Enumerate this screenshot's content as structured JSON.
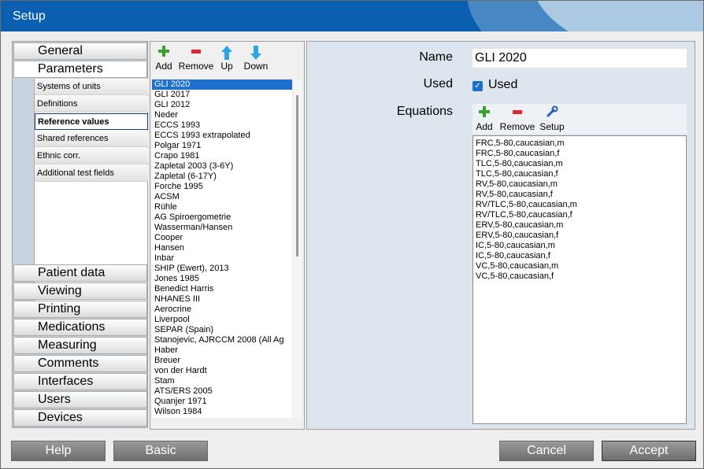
{
  "window": {
    "title": "Setup"
  },
  "nav": {
    "top": [
      {
        "label": "General"
      },
      {
        "label": "Parameters"
      }
    ],
    "sub": [
      {
        "label": "Systems of units"
      },
      {
        "label": "Definitions"
      },
      {
        "label": "Reference values"
      },
      {
        "label": "Shared references"
      },
      {
        "label": "Ethnic corr."
      },
      {
        "label": "Additional test fields"
      }
    ],
    "bottom": [
      {
        "label": "Patient data"
      },
      {
        "label": "Viewing"
      },
      {
        "label": "Printing"
      },
      {
        "label": "Medications"
      },
      {
        "label": "Measuring"
      },
      {
        "label": "Comments"
      },
      {
        "label": "Interfaces"
      },
      {
        "label": "Users"
      },
      {
        "label": "Devices"
      }
    ]
  },
  "ref_toolbar": {
    "add": "Add",
    "remove": "Remove",
    "up": "Up",
    "down": "Down"
  },
  "references": [
    "GLI 2020",
    "GLI 2017",
    "GLI 2012",
    "Neder",
    "ECCS 1993",
    "ECCS 1993 extrapolated",
    "Polgar 1971",
    "Crapo 1981",
    "Zapletal 2003 (3-6Y)",
    "Zapletal (6-17Y)",
    "Forche 1995",
    "ACSM",
    "Rühle",
    "AG Spiroergometrie",
    "Wasserman/Hansen",
    "Cooper",
    "Hansen",
    "Inbar",
    "SHIP (Ewert), 2013",
    "Jones 1985",
    "Benedict Harris",
    "NHANES III",
    "Aerocrine",
    "Liverpool",
    "SEPAR (Spain)",
    "Stanojevic, AJRCCM 2008 (All Ag",
    "Haber",
    "Breuer",
    "von der Hardt",
    "Stam",
    "ATS/ERS 2005",
    "Quanjer 1971",
    "Wilson 1984"
  ],
  "details": {
    "name_label": "Name",
    "name_value": "GLI 2020",
    "used_label": "Used",
    "used_checkbox_label": "Used",
    "equations_label": "Equations",
    "eq_toolbar": {
      "add": "Add",
      "remove": "Remove",
      "setup": "Setup"
    },
    "equations": [
      "FRC,5-80,caucasian,m",
      "FRC,5-80,caucasian,f",
      "TLC,5-80,caucasian,m",
      "TLC,5-80,caucasian,f",
      "RV,5-80,caucasian,m",
      "RV,5-80,caucasian,f",
      "RV/TLC,5-80,caucasian,m",
      "RV/TLC,5-80,caucasian,f",
      "ERV,5-80,caucasian,m",
      "ERV,5-80,caucasian,f",
      "IC,5-80,caucasian,m",
      "IC,5-80,caucasian,f",
      "VC,5-80,caucasian,m",
      "VC,5-80,caucasian,f"
    ]
  },
  "buttons": {
    "help": "Help",
    "basic": "Basic",
    "cancel": "Cancel",
    "accept": "Accept"
  },
  "colors": {
    "titlebar": "#0a5fb0",
    "selection": "#1f6fd1",
    "panel_bg": "#dde5ee"
  }
}
